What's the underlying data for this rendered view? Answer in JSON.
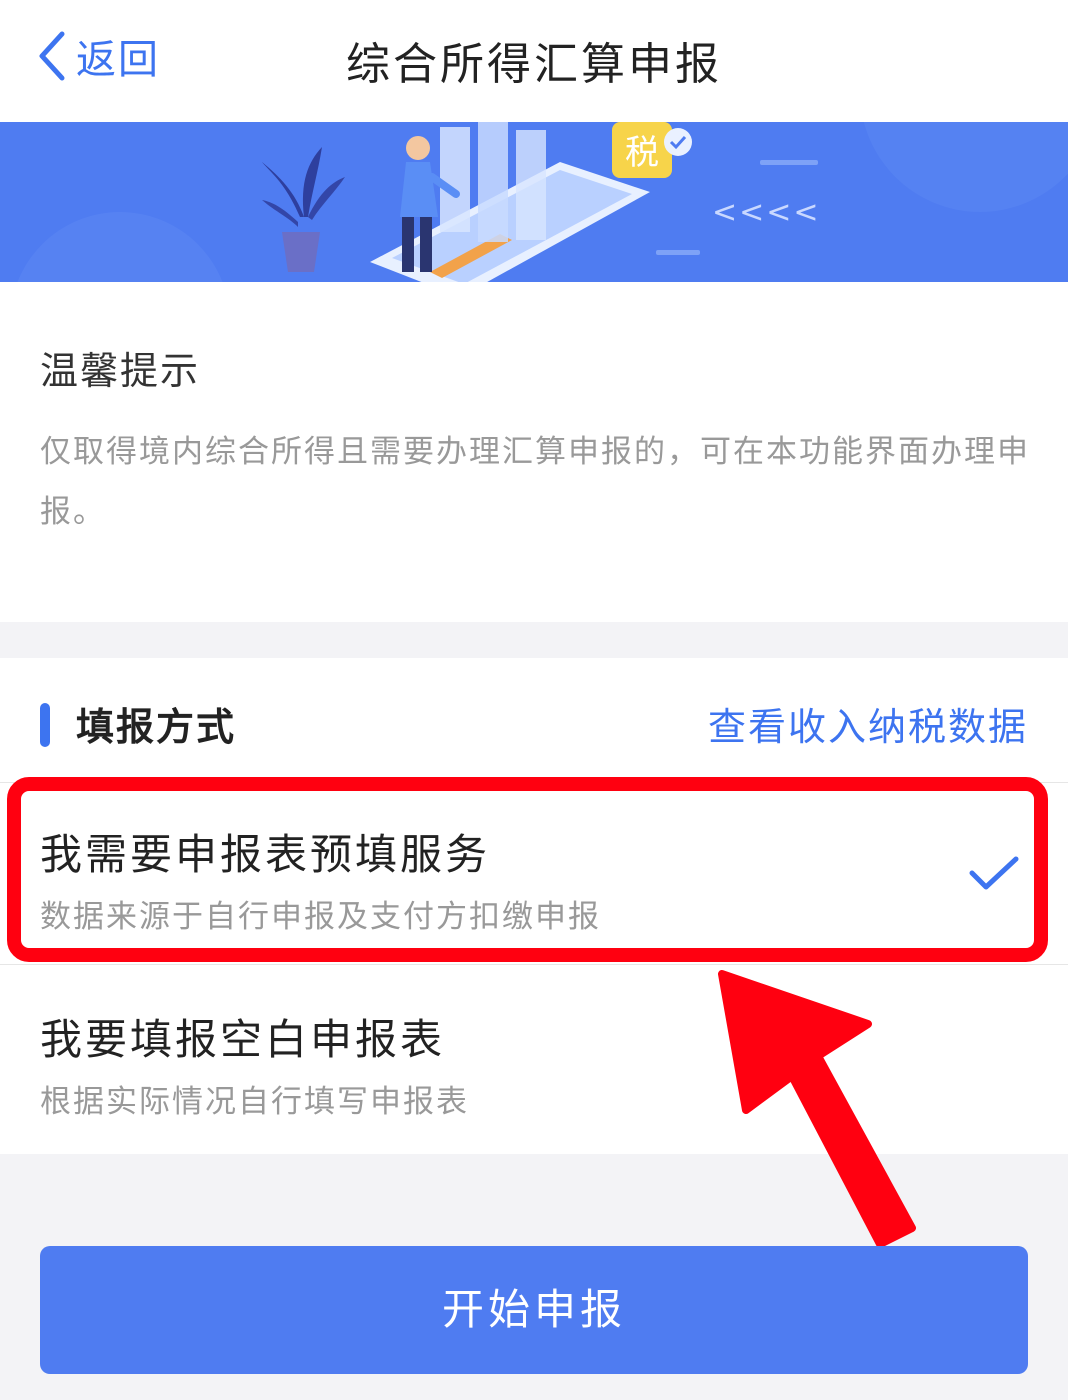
{
  "nav": {
    "back_label": "返回",
    "title": "综合所得汇算申报"
  },
  "banner": {
    "tax_char": "税",
    "arrows": "<<<<"
  },
  "tips": {
    "title": "温馨提示",
    "text": "仅取得境内综合所得且需要办理汇算申报的，可在本功能界面办理申报。"
  },
  "method": {
    "section_title": "填报方式",
    "link": "查看收入纳税数据",
    "options": [
      {
        "title": "我需要申报表预填服务",
        "subtitle": "数据来源于自行申报及支付方扣缴申报",
        "selected": true
      },
      {
        "title": "我要填报空白申报表",
        "subtitle": "根据实际情况自行填写申报表",
        "selected": false
      }
    ]
  },
  "start_button": "开始申报",
  "colors": {
    "accent": "#3d74f0",
    "banner": "#4f7cf1",
    "highlight": "#ff0010"
  }
}
